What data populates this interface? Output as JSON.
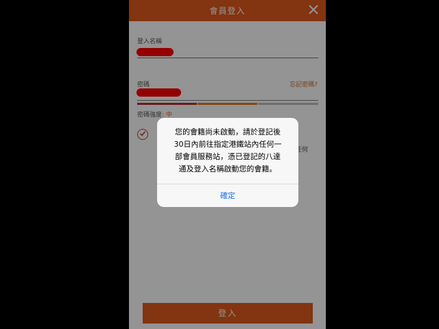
{
  "header": {
    "title": "會員登入"
  },
  "form": {
    "username_label": "登入名稱",
    "password_label": "密碼",
    "forgot_password": "忘記密碼?",
    "strength_label": "密碼強度:",
    "strength_value": "中",
    "partial_text": "任何",
    "login_button": "登入"
  },
  "dialog": {
    "message_lines": [
      "您的會籍尚未啟動，請於登記後",
      "30日內前往指定港鐵站內任何一",
      "部會員服務站，憑已登記的八達",
      "通及登入名稱啟動您的會籍。"
    ],
    "confirm": "確定"
  },
  "colors": {
    "brand": "#e25a1c",
    "redaction": "#ff0000",
    "link": "#1a73e8"
  }
}
